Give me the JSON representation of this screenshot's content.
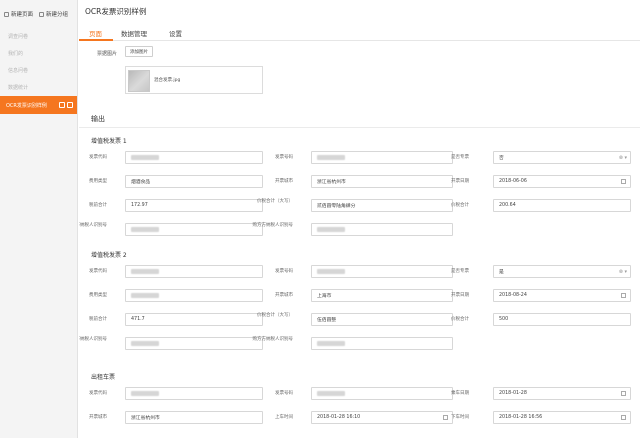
{
  "sidebar": {
    "new_page": "新建页面",
    "new_group": "新建分组",
    "items": [
      "调查问卷",
      "我们的",
      "信息问卷",
      "数据统计"
    ],
    "active_item": "OCR发票识别样例"
  },
  "header": {
    "title": "OCR发票识别样例",
    "tabs": [
      "页面",
      "数据管理",
      "设置"
    ]
  },
  "upload": {
    "label": "票据图片",
    "button": "添加图片",
    "file_name": "混合发票.jpg"
  },
  "output": {
    "heading": "输出",
    "sections": [
      {
        "title": "增值税发票 1",
        "fields": [
          {
            "label": "发票代码",
            "value": "",
            "blurred": true
          },
          {
            "label": "发票号码",
            "value": "",
            "blurred": true
          },
          {
            "label": "是否专票",
            "value": "否",
            "kind": "select"
          },
          {
            "label": "费用类型",
            "value": "烟酒食品"
          },
          {
            "label": "开票城市",
            "value": "浙江省杭州市"
          },
          {
            "label": "开票日期",
            "value": "2018-06-06",
            "kind": "date"
          },
          {
            "label": "税前合计",
            "value": "172.97"
          },
          {
            "label": "价税合计（大写）",
            "value": "贰佰圆零陆角肆分"
          },
          {
            "label": "价税合计",
            "value": "200.64"
          },
          {
            "label": "销售方纳税人识别号",
            "value": "",
            "blurred": true
          },
          {
            "label": "购方方纳税人识别号",
            "value": "",
            "blurred": true
          }
        ]
      },
      {
        "title": "增值税发票 2",
        "fields": [
          {
            "label": "发票代码",
            "value": "",
            "blurred": true
          },
          {
            "label": "发票号码",
            "value": "",
            "blurred": true
          },
          {
            "label": "是否专票",
            "value": "是",
            "kind": "select"
          },
          {
            "label": "费用类型",
            "value": "",
            "blurred": true
          },
          {
            "label": "开票城市",
            "value": "上海市"
          },
          {
            "label": "开票日期",
            "value": "2018-08-24",
            "kind": "date"
          },
          {
            "label": "税前合计",
            "value": "471.7"
          },
          {
            "label": "价税合计（大写）",
            "value": "伍佰圆整"
          },
          {
            "label": "价税合计",
            "value": "500"
          },
          {
            "label": "销售方纳税人识别号",
            "value": "",
            "blurred": true
          },
          {
            "label": "购方方纳税人识别号",
            "value": "",
            "blurred": true
          }
        ]
      },
      {
        "title": "出租车票",
        "fields": [
          {
            "label": "发票代码",
            "value": "",
            "blurred": true
          },
          {
            "label": "发票号码",
            "value": "",
            "blurred": true
          },
          {
            "label": "乘车日期",
            "value": "2018-01-28",
            "kind": "date"
          },
          {
            "label": "开票城市",
            "value": "浙江省杭州市"
          },
          {
            "label": "上车时间",
            "value": "2018-01-28 16:10",
            "kind": "date"
          },
          {
            "label": "下车时间",
            "value": "2018-01-28 16:56",
            "kind": "date"
          }
        ]
      }
    ]
  },
  "colors": {
    "accent": "#f5761f"
  }
}
